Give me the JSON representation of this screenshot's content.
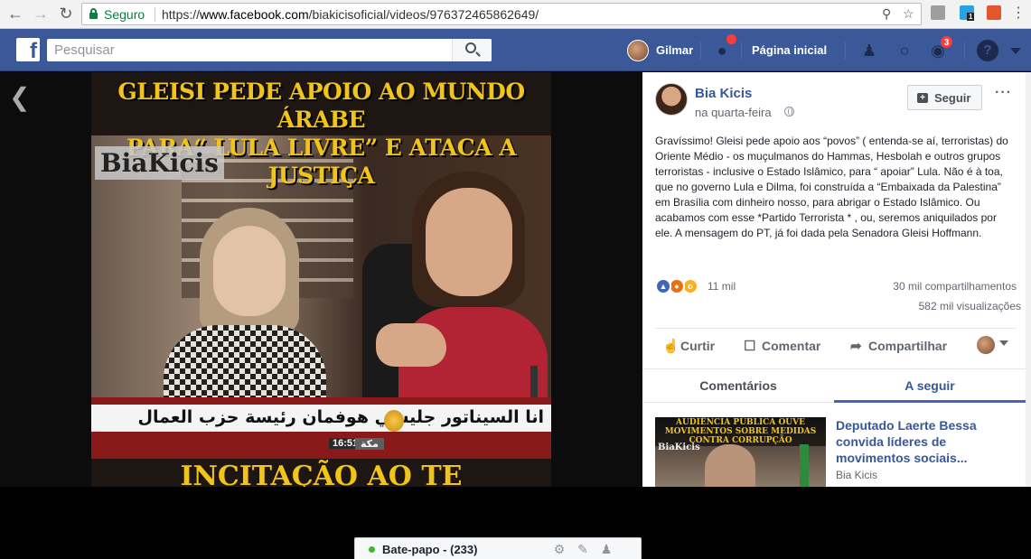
{
  "browser": {
    "secure_label": "Seguro",
    "url_prefix": "https://",
    "url_host": "www.facebook.com",
    "url_path": "/biakicisoficial/videos/976372465862649/",
    "extension_badge": "1"
  },
  "fb_header": {
    "search_placeholder": "Pesquisar",
    "user_name": "Gilmar",
    "home_label": "Página inicial",
    "notifications_count": "3"
  },
  "video": {
    "headline_line1": "GLEISI PEDE APOIO AO MUNDO ÁRABE",
    "headline_line2": "PARA“ LULA LIVRE” E ATACA A JUSTIÇA",
    "watermark": "BiaKicis",
    "ticker_arabic": "انا السيناتور جليسي هوفمان رئيسة حزب العمال",
    "clock": "16:51",
    "location": "مكة",
    "caption": "INCITAÇÃO AO TE"
  },
  "chat": {
    "label": "Bate-papo - (233)"
  },
  "post": {
    "author": "Bia Kicis",
    "date": "na quarta-feira",
    "follow_label": "Seguir",
    "more": "···",
    "text": "Gravíssimo! Gleisi pede apoio aos “povos” ( entenda-se aí, terroristas) do Oriente Médio - os muçulmanos do Hammas, Hesbolah e outros grupos terroristas - inclusive o Estado Islâmico, para “ apoiar” Lula. Não é à toa, que no governo Lula e Dilma, foi construída a “Embaixada da Palestina” em Brasília com dinheiro nosso, para abrigar o Estado Islâmico. Ou acabamos com esse *Partido Terrorista * , ou, seremos aniquilados por ele. A mensagem do PT, já foi dada pela Senadora Gleisi Hoffmann.",
    "reactions_count": "11 mil",
    "shares": "30 mil compartilhamentos",
    "views": "582 mil visualizações",
    "actions": {
      "like": "Curtir",
      "comment": "Comentar",
      "share": "Compartilhar"
    }
  },
  "tabs": {
    "comments": "Comentários",
    "up_next": "A seguir"
  },
  "next_video": {
    "thumb_title": "AUDIÊNCIA PÚBLICA OUVE MOVIMENTOS SOBRE MEDIDAS CONTRA CORRUPÇÃO",
    "thumb_watermark": "BiaKicis",
    "title": "Deputado Laerte Bessa convida líderes de movimentos sociais...",
    "author": "Bia Kicis"
  },
  "colors": {
    "fb_blue": "#3b5998",
    "link_blue": "#365899",
    "secure_green": "#0b8043",
    "headline_yellow": "#f0c419"
  }
}
